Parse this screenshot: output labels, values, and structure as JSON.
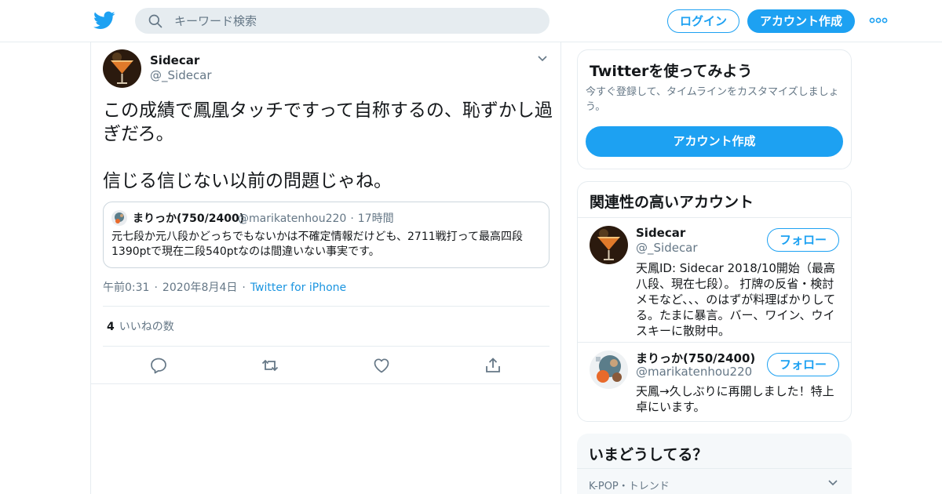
{
  "header": {
    "logo_icon": "twitter-bird-icon",
    "search_placeholder": "キーワード検索",
    "login_label": "ログイン",
    "signup_label": "アカウント作成",
    "more_icon": "more-dots-icon",
    "accent_color": "#1da1f2"
  },
  "tweet": {
    "author_name": "Sidecar",
    "author_handle": "@_Sidecar",
    "text": "この成績で鳳凰タッチですって自称するの、恥ずかし過ぎだろ。\n\n信じる信じない以前の問題じゃね。",
    "quote": {
      "name": "まりっか(750/2400)",
      "handle": "@marikatenhou220",
      "time": "17時間",
      "text": "元七段か元八段かどっちでもないかは不確定情報だけども、2711戦打って最高四段1390ptで現在二段540ptなのは間違いない事実です。"
    },
    "time": "午前0:31",
    "date": "2020年8月4日",
    "source": "Twitter for iPhone",
    "likes_count": "4",
    "likes_label": "いいねの数",
    "actions": [
      "reply-icon",
      "retweet-icon",
      "like-icon",
      "share-icon"
    ]
  },
  "sidebar": {
    "try": {
      "title": "Twitterを使ってみよう",
      "subtitle": "今すぐ登録して、タイムラインをカスタマイズしましょう。",
      "button": "アカウント作成"
    },
    "related": {
      "title": "関連性の高いアカウント",
      "accounts": [
        {
          "name": "Sidecar",
          "handle": "@_Sidecar",
          "bio": "天鳳ID: Sidecar 2018/10開始（最高八段、現在七段）。 打牌の反省・検討メモなど、、、のはずが料理ばかりしてる。たまに暴言。バー、ワイン、ウイスキーに散財中。",
          "follow": "フォロー"
        },
        {
          "name": "まりっか(750/2400)",
          "handle": "@marikatenhou220",
          "bio": "天鳳→久しぶりに再開しました！特上卓にいます。",
          "follow": "フォロー"
        }
      ]
    },
    "trends": {
      "title": "いまどうしてる？",
      "first_label": "K-POP・トレンド"
    }
  }
}
